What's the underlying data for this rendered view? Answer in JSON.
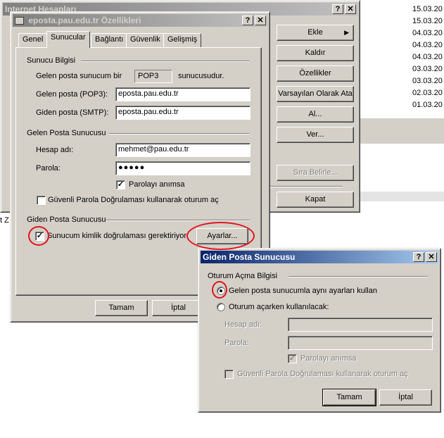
{
  "background_window": {
    "title": "Internet Hesapları",
    "help_button": "?",
    "close_button": "✕",
    "side_buttons": {
      "add": "Ekle",
      "remove": "Kaldır",
      "properties": "Özellikler",
      "set_default": "Varsayılan Olarak Ata",
      "import": "Al...",
      "export": "Ver...",
      "set_order": "Sıra Belirle...",
      "close": "Kapat"
    },
    "dates": [
      "15.03.20",
      "15.03.20",
      "04.03.20",
      "04.03.20",
      "04.03.20",
      "03.03.20",
      "03.03.20",
      "02.03.20",
      "01.03.20"
    ],
    "edge_fragment": "t Z"
  },
  "properties_dialog": {
    "title": "eposta.pau.edu.tr Özellikleri",
    "help_button": "?",
    "close_button": "✕",
    "tabs": [
      "Genel",
      "Sunucular",
      "Bağlantı",
      "Güvenlik",
      "Gelişmiş"
    ],
    "active_tab": "Sunucular",
    "server_info": {
      "section_title": "Sunucu Bilgisi",
      "incoming_type_prefix": "Gelen posta sunucum bir",
      "incoming_type_value": "POP3",
      "incoming_type_suffix": "sunucusudur.",
      "incoming_label": "Gelen posta (POP3):",
      "incoming_value": "eposta.pau.edu.tr",
      "outgoing_label": "Giden posta (SMTP):",
      "outgoing_value": "eposta.pau.edu.tr"
    },
    "incoming_server": {
      "section_title": "Gelen Posta Sunucusu",
      "account_label": "Hesap adı:",
      "account_value": "mehmet@pau.edu.tr",
      "password_label": "Parola:",
      "password_value": "●●●●●",
      "remember_label": "Parolayı anımsa",
      "remember_checked": true,
      "spa_label": "Güvenli Parola Doğrulaması kullanarak oturum aç",
      "spa_checked": false
    },
    "outgoing_server": {
      "section_title": "Giden Posta Sunucusu",
      "auth_label": "Sunucum kimlik doğrulaması gerektiriyor",
      "auth_checked": true,
      "settings_button": "Ayarlar..."
    },
    "ok_button": "Tamam",
    "cancel_button": "İptal"
  },
  "outgoing_dialog": {
    "title": "Giden Posta Sunucusu",
    "help_button": "?",
    "close_button": "✕",
    "section_title": "Oturum Açma Bilgisi",
    "radio_same": "Gelen posta sunucumla aynı ayarları kullan",
    "radio_same_selected": true,
    "radio_login": "Oturum açarken kullanılacak:",
    "account_label": "Hesap adı:",
    "account_value": "",
    "password_label": "Parola:",
    "password_value": "",
    "remember_label": "Parolayı anımsa",
    "remember_checked": true,
    "spa_label": "Güvenli Parola Doğrulaması kullanarak oturum aç",
    "spa_checked": false,
    "ok_button": "Tamam",
    "cancel_button": "İptal"
  },
  "colors": {
    "window_face": "#d4d0c8",
    "active_title": "#0a246a",
    "highlight_ellipse": "#e0141e"
  }
}
